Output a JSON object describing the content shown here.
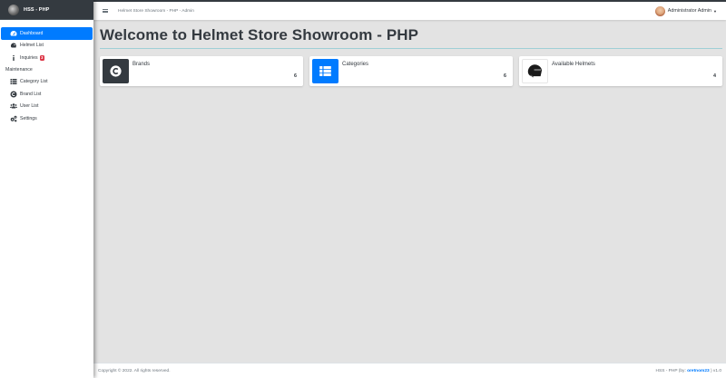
{
  "brand": {
    "name": "HSS - PHP"
  },
  "sidebar": {
    "items": [
      {
        "label": "Dashboard",
        "icon": "tachometer-icon",
        "active": true
      },
      {
        "label": "Helmet List",
        "icon": "helmet-icon",
        "active": false
      },
      {
        "label": "Inquiries",
        "icon": "info-icon",
        "active": false,
        "badge": "3"
      }
    ],
    "section_header": "Maintenance",
    "maintenance_items": [
      {
        "label": "Category List",
        "icon": "th-list-icon"
      },
      {
        "label": "Brand List",
        "icon": "copyright-icon"
      },
      {
        "label": "User List",
        "icon": "users-icon"
      },
      {
        "label": "Settings",
        "icon": "cogs-icon"
      }
    ]
  },
  "navbar": {
    "title": "Helmet Store Showroom - PHP - Admin",
    "user_name": "Administrator Admin"
  },
  "main": {
    "page_title": "Welcome to Helmet Store Showroom - PHP",
    "cards": [
      {
        "label": "Brands",
        "count": "6",
        "icon": "copyright-icon",
        "color": "#343a40"
      },
      {
        "label": "Categories",
        "count": "6",
        "icon": "th-list-icon",
        "color": "#007bff"
      },
      {
        "label": "Available Helmets",
        "count": "4",
        "icon": "helmet-icon",
        "color": "#ffffff"
      }
    ]
  },
  "footer": {
    "copyright": "Copyright © 2022. All rights reserved.",
    "credit_prefix": "HSS - PHP (by: ",
    "credit_author": "oretnom23",
    "credit_suffix": " ) v1.0"
  },
  "colors": {
    "primary": "#007bff",
    "dark": "#343a40",
    "danger": "#dc3545",
    "background": "#e3e3e3"
  }
}
